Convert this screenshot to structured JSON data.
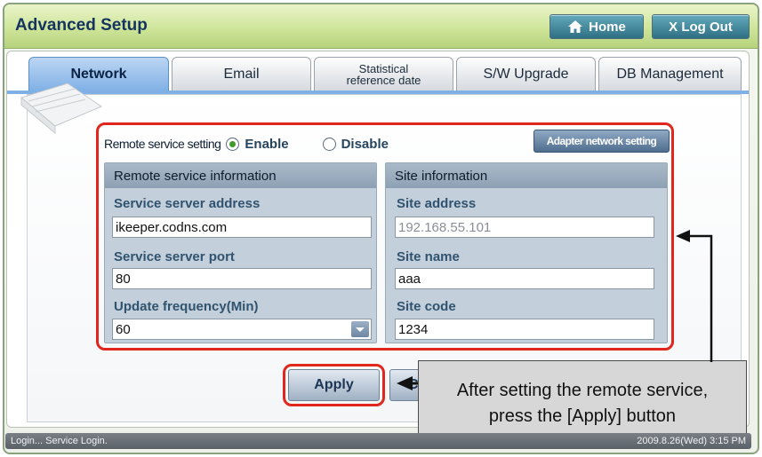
{
  "window": {
    "title": "Advanced Setup"
  },
  "header": {
    "home_label": "Home",
    "logout_label": "X Log Out"
  },
  "tabs": [
    {
      "label": "Network"
    },
    {
      "label": "Email"
    },
    {
      "label_line1": "Statistical",
      "label_line2": "reference date"
    },
    {
      "label": "S/W Upgrade"
    },
    {
      "label": "DB Management"
    }
  ],
  "remote": {
    "setting_label": "Remote service setting",
    "enable_label": "Enable",
    "disable_label": "Disable",
    "selected": "Enable",
    "adapter_button": "Adapter network setting"
  },
  "remote_info": {
    "title": "Remote service information",
    "server_address_label": "Service server address",
    "server_address_value": "ikeeper.codns.com",
    "server_port_label": "Service server port",
    "server_port_value": "80",
    "update_freq_label": "Update frequency(Min)",
    "update_freq_value": "60"
  },
  "site_info": {
    "title": "Site information",
    "address_label": "Site address",
    "address_value": "192.168.55.101",
    "name_label": "Site name",
    "name_value": "aaa",
    "code_label": "Site code",
    "code_value": "1234"
  },
  "actions": {
    "apply_label": "Apply",
    "cancel_label": "C"
  },
  "callout": {
    "line1": "After setting the remote service,",
    "line2": "press the [Apply] button"
  },
  "status": {
    "left": "Login... Service Login.",
    "right": "2009.8.26(Wed)  3:15 PM"
  },
  "colors": {
    "highlight": "#e0261d",
    "active_tab": "#7fb0e5",
    "title_bar": "#cfe59a"
  }
}
